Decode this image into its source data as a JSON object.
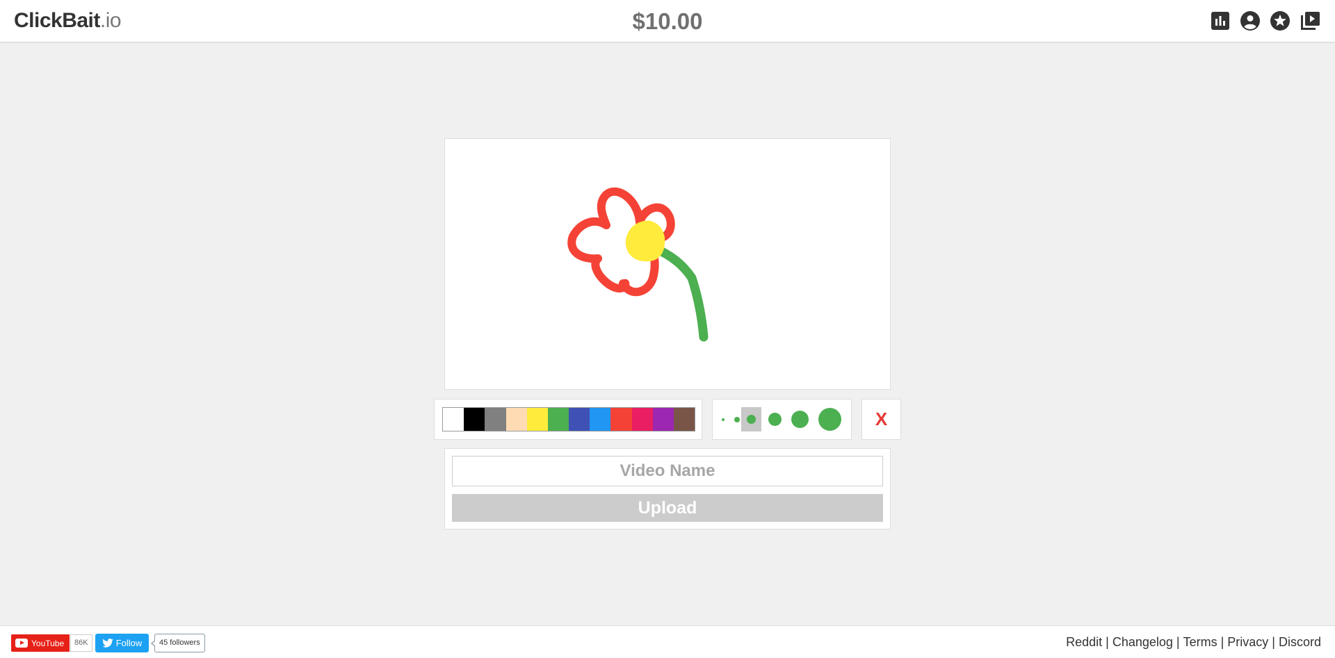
{
  "header": {
    "logo_main": "ClickBait",
    "logo_tld": ".io",
    "balance": "$10.00",
    "icons": [
      "stats-icon",
      "account-icon",
      "favorites-star-icon",
      "video-library-icon"
    ]
  },
  "canvas": {
    "drawing_description_colors": {
      "petals": "#f44336",
      "center": "#ffeb3b",
      "stem": "#4caf50"
    }
  },
  "palette": {
    "colors": [
      "#ffffff",
      "#000000",
      "#808080",
      "#ffdbb4",
      "#ffeb3b",
      "#4caf50",
      "#3f51b5",
      "#2196f3",
      "#f44336",
      "#e91e63",
      "#9c27b0",
      "#795548"
    ]
  },
  "brush": {
    "color": "#4caf50",
    "selected_index": 2
  },
  "clear_label": "X",
  "form": {
    "name_placeholder": "Video Name",
    "name_value": "",
    "upload_label": "Upload"
  },
  "footer": {
    "youtube_label": "YouTube",
    "youtube_count": "86K",
    "twitter_label": "Follow",
    "twitter_count": "45 followers",
    "links": [
      "Reddit",
      "Changelog",
      "Terms",
      "Privacy",
      "Discord"
    ]
  }
}
